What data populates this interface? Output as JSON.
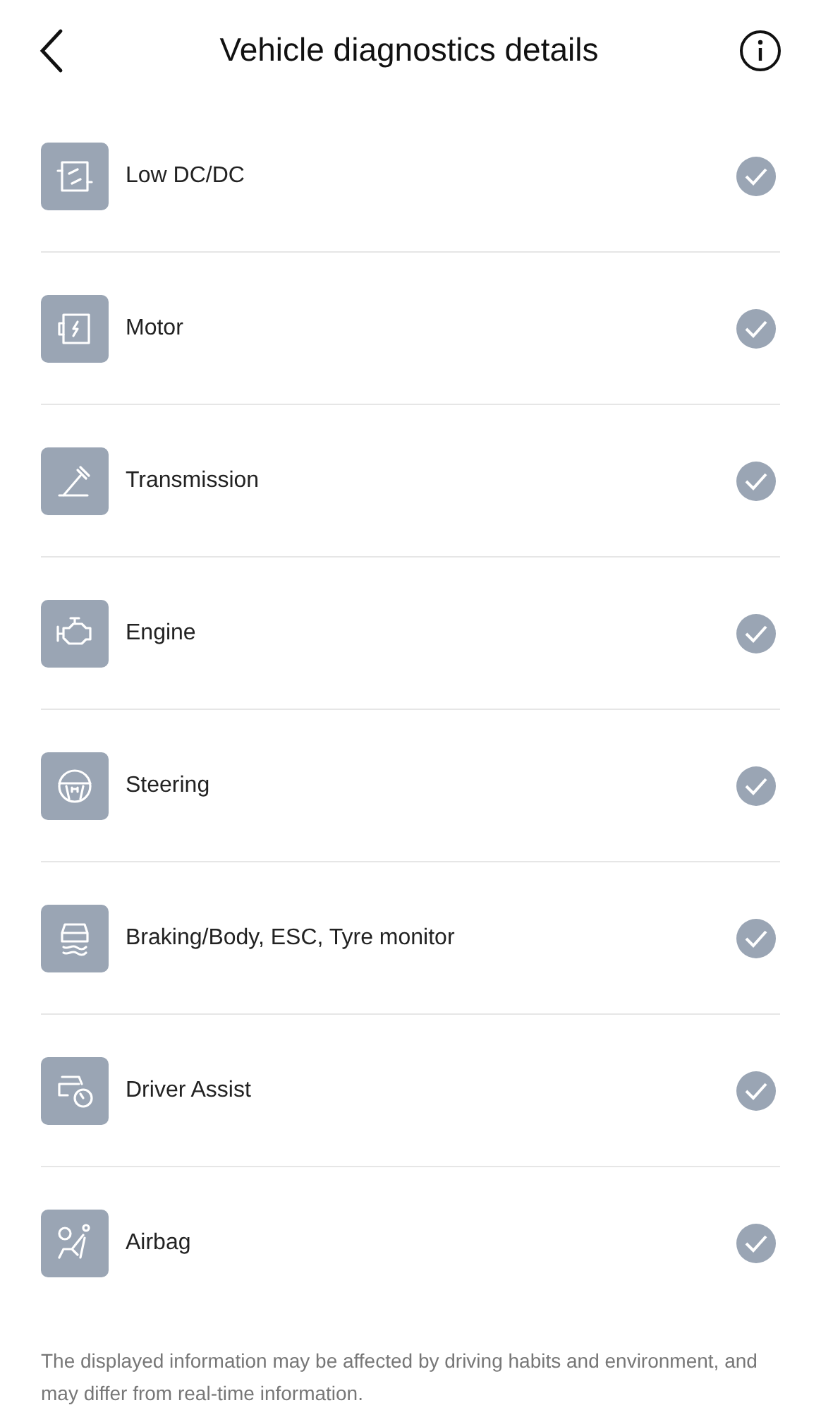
{
  "header": {
    "title": "Vehicle diagnostics details"
  },
  "items": [
    {
      "kind": "dcdc",
      "label": "Low DC/DC",
      "ok": true
    },
    {
      "kind": "motor",
      "label": "Motor",
      "ok": true
    },
    {
      "kind": "transmission",
      "label": "Transmission",
      "ok": true
    },
    {
      "kind": "engine",
      "label": "Engine",
      "ok": true
    },
    {
      "kind": "steering",
      "label": "Steering",
      "ok": true
    },
    {
      "kind": "braking",
      "label": "Braking/Body, ESC, Tyre monitor",
      "ok": true
    },
    {
      "kind": "assist",
      "label": "Driver Assist",
      "ok": true
    },
    {
      "kind": "airbag",
      "label": "Airbag",
      "ok": true
    }
  ],
  "footer": "The displayed information may be affected by driving habits and environment, and may differ from real-time information."
}
